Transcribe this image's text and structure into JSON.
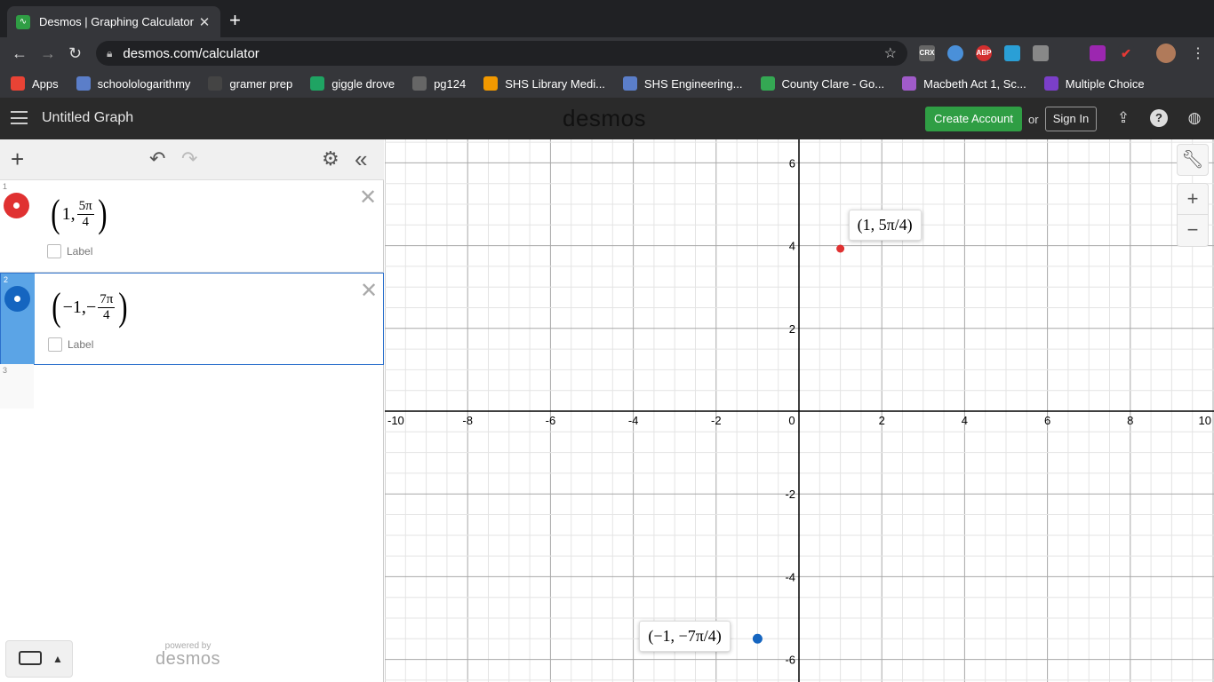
{
  "browser": {
    "tab_title": "Desmos | Graphing Calculator",
    "url": "desmos.com/calculator",
    "bookmarks": [
      {
        "label": "Apps",
        "color": "#e94335"
      },
      {
        "label": "schoolologarithmy",
        "color": "#5b7ec9"
      },
      {
        "label": "gramer prep",
        "color": "#444444"
      },
      {
        "label": "giggle drove",
        "color": "#1fa463"
      },
      {
        "label": "pg124",
        "color": "#666666"
      },
      {
        "label": "SHS Library Medi...",
        "color": "#f29900"
      },
      {
        "label": "SHS Engineering...",
        "color": "#5b7ec9"
      },
      {
        "label": "County Clare - Go...",
        "color": "#34a853"
      },
      {
        "label": "Macbeth Act 1, Sc...",
        "color": "#a05bc9"
      },
      {
        "label": "Multiple Choice",
        "color": "#7b3fc9"
      }
    ],
    "extensions": [
      "CRX",
      "ABP"
    ]
  },
  "app": {
    "graph_title": "Untitled Graph",
    "logo": "desmos",
    "create_account": "Create Account",
    "or": "or",
    "sign_in": "Sign In"
  },
  "expressions": [
    {
      "index": "1",
      "x": "1,",
      "frac_num": "5π",
      "frac_den": "4",
      "neg": "",
      "color": "#e03131",
      "label": "Label"
    },
    {
      "index": "2",
      "x": "−1,",
      "frac_num": "7π",
      "frac_den": "4",
      "neg": "−",
      "color": "#1565c0",
      "label": "Label"
    },
    {
      "index": "3"
    }
  ],
  "powered_by": {
    "line1": "powered by",
    "line2": "desmos"
  },
  "graph": {
    "x_range": [
      -10,
      10
    ],
    "y_range": [
      -6.5,
      6.5
    ],
    "x_ticks": [
      "-10",
      "-8",
      "-6",
      "-4",
      "-2",
      "0",
      "2",
      "4",
      "6",
      "8",
      "10"
    ],
    "y_ticks": [
      "6",
      "4",
      "2",
      "-2",
      "-4",
      "-6"
    ],
    "points": [
      {
        "name": "point-1",
        "x": 1,
        "y": 3.927,
        "color": "#e03131",
        "tooltip": "(1, 5π/4)"
      },
      {
        "name": "point-2",
        "x": -1,
        "y": -5.498,
        "color": "#1565c0",
        "tooltip": "(−1, −7π/4)"
      }
    ]
  }
}
